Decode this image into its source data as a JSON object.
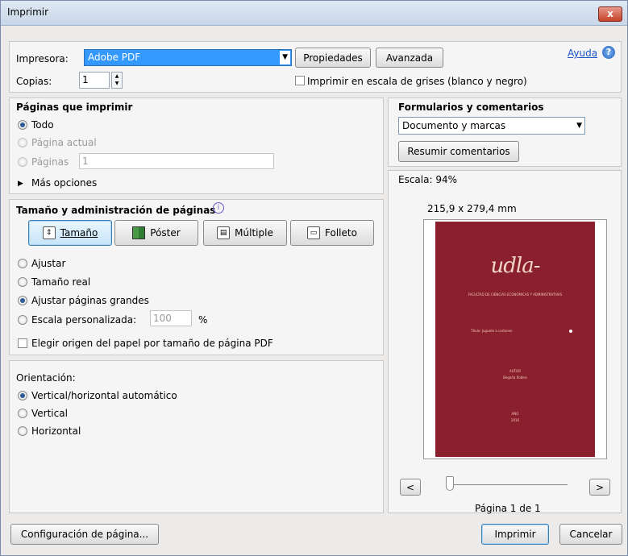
{
  "title": "Imprimir",
  "close_label": "x",
  "printer": {
    "label": "Impresora:",
    "value": "Adobe PDF",
    "properties": "Propiedades",
    "advanced": "Avanzada",
    "help": "Ayuda"
  },
  "copies": {
    "label": "Copias:",
    "value": "1"
  },
  "grayscale": {
    "label": "Imprimir en escala de grises (blanco y negro)"
  },
  "pages": {
    "header": "Páginas que imprimir",
    "all": "Todo",
    "current": "Página actual",
    "pages_label": "Páginas",
    "pages_value": "1",
    "more": "Más opciones"
  },
  "sizing": {
    "header": "Tamaño y administración de páginas",
    "buttons": {
      "size": "Tamaño",
      "poster": "Póster",
      "multiple": "Múltiple",
      "booklet": "Folleto"
    },
    "fit": "Ajustar",
    "actual": "Tamaño real",
    "shrink": "Ajustar páginas grandes",
    "custom": "Escala personalizada:",
    "custom_value": "100",
    "percent": "%",
    "paper_source": "Elegir origen del papel por tamaño de página PDF"
  },
  "orientation": {
    "header": "Orientación:",
    "auto": "Vertical/horizontal automático",
    "portrait": "Vertical",
    "landscape": "Horizontal"
  },
  "forms": {
    "header": "Formularios y comentarios",
    "value": "Documento y marcas",
    "summarize": "Resumir comentarios"
  },
  "preview": {
    "scale": "Escala: 94%",
    "dimensions": "215,9 x 279,4 mm",
    "page_indicator": "Página 1 de 1",
    "prev": "<",
    "next": ">",
    "doc": {
      "logo": "udla-",
      "faculty": "FACULTAD DE CIENCIAS ECONÓMICAS Y ADMINISTRATIVAS",
      "title_line": "Título: Juguete a cartones",
      "author_label": "AUTOR",
      "author": "Begoña Robles",
      "year_label": "AÑO",
      "year": "2016"
    }
  },
  "footer": {
    "page_setup": "Configuración de página...",
    "print": "Imprimir",
    "cancel": "Cancelar"
  },
  "colors": {
    "accent": "#3399ff",
    "cover": "#8a1f2d"
  }
}
